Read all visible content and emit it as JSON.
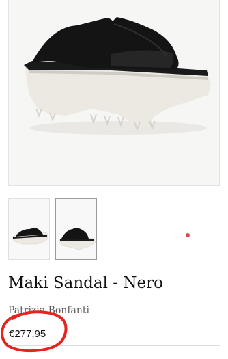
{
  "product": {
    "title": "Maki Sandal - Nero",
    "brand": "Patrizia Bonfanti",
    "price": "€277,95"
  },
  "gallery": {
    "main_image_icon": "sandal-photo-icon",
    "thumbnail_icons": [
      "sandal-side-view-icon",
      "sandal-angle-view-icon"
    ],
    "active_thumbnail": 2
  },
  "colors": {
    "pager_dot": "#e0454f",
    "annotation": "#e8231f",
    "sole": "#ece9e2",
    "upper": "#141414"
  }
}
